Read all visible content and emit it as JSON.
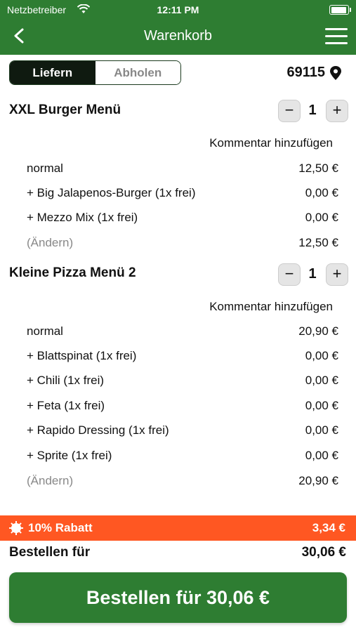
{
  "status": {
    "carrier": "Netzbetreiber",
    "time": "12:11 PM"
  },
  "header": {
    "title": "Warenkorb"
  },
  "delivery": {
    "options": [
      "Liefern",
      "Abholen"
    ],
    "selected": "Liefern",
    "zip": "69115"
  },
  "cart": [
    {
      "name": "XXL Burger Menü",
      "quantity": "1",
      "comment_label": "Kommentar hinzufügen",
      "lines": [
        {
          "label": "normal",
          "price": "12,50 €"
        },
        {
          "label": "+ Big Jalapenos-Burger (1x frei)",
          "price": "0,00 €"
        },
        {
          "label": "+ Mezzo Mix (1x frei)",
          "price": "0,00 €"
        },
        {
          "label": "(Ändern)",
          "price": "12,50 €"
        }
      ]
    },
    {
      "name": "Kleine Pizza Menü 2",
      "quantity": "1",
      "comment_label": "Kommentar hinzufügen",
      "lines": [
        {
          "label": "normal",
          "price": "20,90 €"
        },
        {
          "label": "+ Blattspinat (1x frei)",
          "price": "0,00 €"
        },
        {
          "label": "+ Chili (1x frei)",
          "price": "0,00 €"
        },
        {
          "label": "+ Feta (1x frei)",
          "price": "0,00 €"
        },
        {
          "label": "+ Rapido Dressing (1x frei)",
          "price": "0,00 €"
        },
        {
          "label": "+ Sprite (1x frei)",
          "price": "0,00 €"
        },
        {
          "label": "(Ändern)",
          "price": "20,90 €"
        }
      ]
    }
  ],
  "discount": {
    "label": "10% Rabatt",
    "amount": "3,34 €"
  },
  "total": {
    "label": "Bestellen für",
    "amount": "30,06 €"
  },
  "order_button": "Bestellen für 30,06 €",
  "colors": {
    "primary": "#2e7d32",
    "discount": "#ff5722",
    "segment_active": "#0f1a10"
  },
  "icons": [
    "wifi-icon",
    "battery-icon",
    "back-chevron-icon",
    "hamburger-menu-icon",
    "location-pin-icon",
    "minus-icon",
    "plus-icon",
    "discount-badge-icon"
  ]
}
